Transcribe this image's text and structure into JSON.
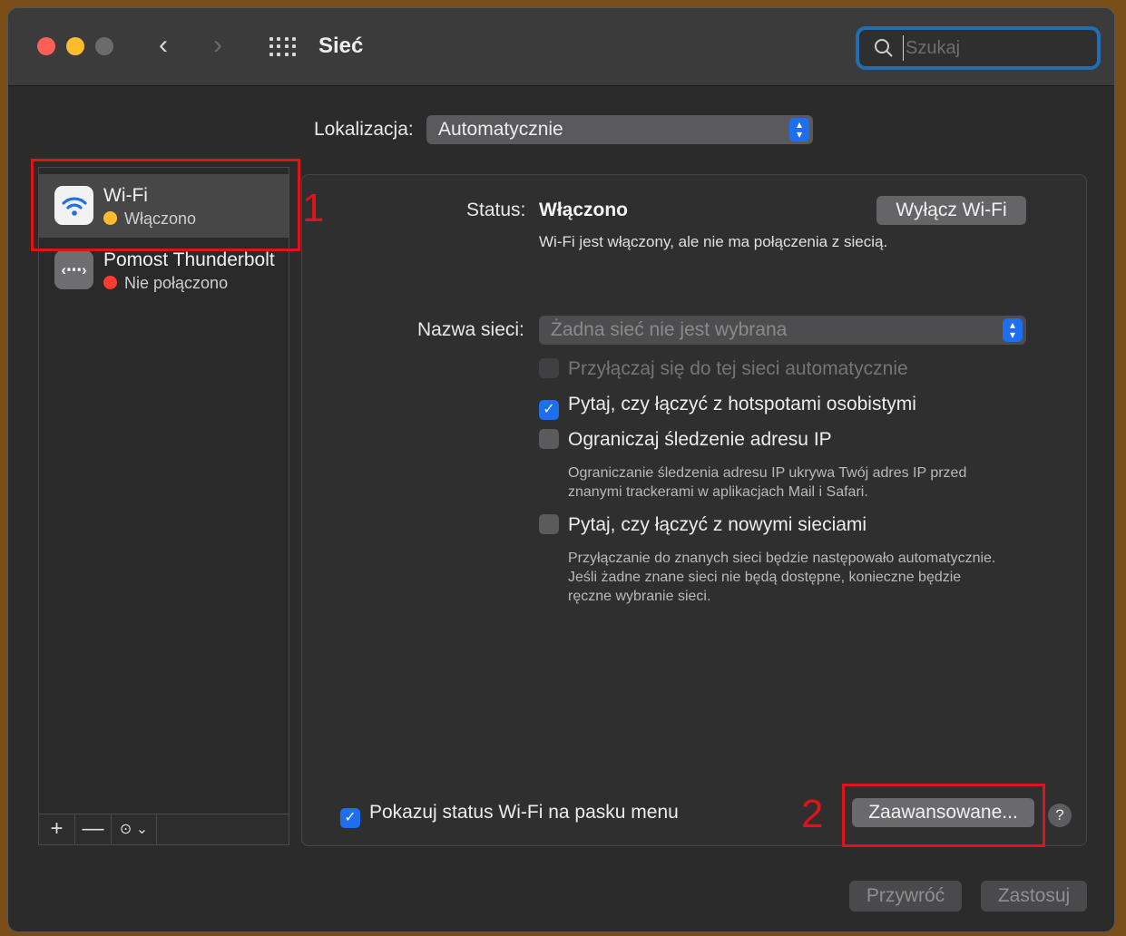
{
  "window": {
    "title": "Sieć",
    "search_placeholder": "Szukaj"
  },
  "location": {
    "label": "Lokalizacja:",
    "value": "Automatycznie"
  },
  "sidebar": {
    "items": [
      {
        "name": "Wi-Fi",
        "status": "Włączono",
        "status_color": "#febc2e",
        "icon": "wifi-icon",
        "selected": true
      },
      {
        "name": "Pomost Thunderbolt",
        "status": "Nie połączono",
        "status_color": "#fe3b30",
        "icon": "thunderbolt-bridge-icon",
        "selected": false
      }
    ],
    "add_label": "+",
    "remove_label": "—",
    "action_label": "⊙ ⌄"
  },
  "annotations": {
    "one": "1",
    "two": "2",
    "color": "#e2121b"
  },
  "wifi": {
    "status_label": "Status:",
    "status_value": "Włączono",
    "toggle_button": "Wyłącz Wi-Fi",
    "status_description": "Wi-Fi jest włączony, ale nie ma połączenia z siecią.",
    "network_label": "Nazwa sieci:",
    "network_value": "Żadna sieć nie jest wybrana",
    "options": {
      "auto_join": {
        "label": "Przyłączaj się do tej sieci automatycznie",
        "checked": false,
        "enabled": false
      },
      "ask_hotspots": {
        "label": "Pytaj, czy łączyć z hotspotami osobistymi",
        "checked": true
      },
      "limit_ip": {
        "label": "Ograniczaj śledzenie adresu IP",
        "checked": false,
        "hint_line1": "Ograniczanie śledzenia adresu IP ukrywa Twój adres IP przed",
        "hint_line2": "znanymi trackerami w aplikacjach Mail i Safari."
      },
      "ask_new": {
        "label": "Pytaj, czy łączyć z nowymi sieciami",
        "checked": false,
        "hint_line1": "Przyłączanie do znanych sieci będzie następowało automatycznie.",
        "hint_line2": "Jeśli żadne znane sieci nie będą dostępne, konieczne będzie",
        "hint_line3": "ręczne wybranie sieci."
      }
    },
    "show_status_label": "Pokazuj status Wi-Fi na pasku menu",
    "show_status_checked": true,
    "advanced_button": "Zaawansowane...",
    "help_label": "?"
  },
  "footer": {
    "revert_button": "Przywróć",
    "apply_button": "Zastosuj"
  },
  "colors": {
    "accent": "#1d6ff0",
    "window_bg": "#2b2b2c"
  }
}
